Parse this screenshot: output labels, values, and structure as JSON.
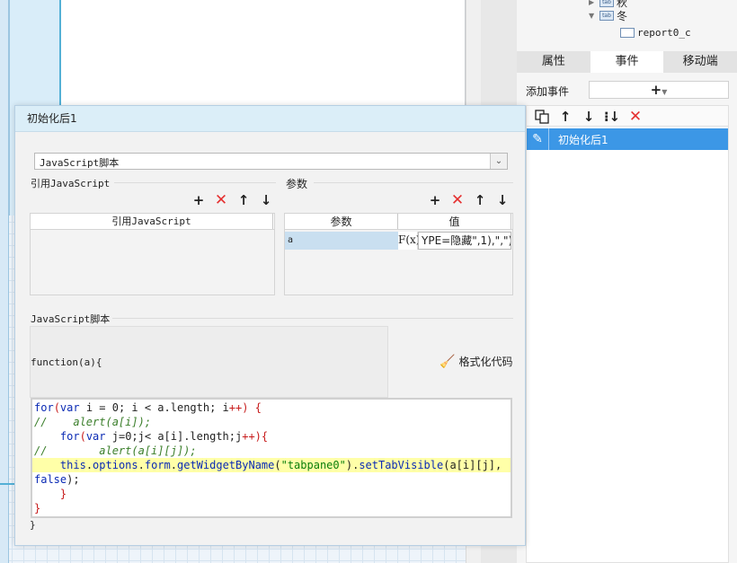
{
  "tree": {
    "items": [
      {
        "label": "秋",
        "icon": "tab-icon",
        "expanded": false
      },
      {
        "label": "冬",
        "icon": "tab-icon",
        "expanded": true
      },
      {
        "label": "report0_c",
        "icon": "report-icon"
      }
    ]
  },
  "panel_tabs": [
    {
      "label": "属性",
      "active": false
    },
    {
      "label": "事件",
      "active": true
    },
    {
      "label": "移动端",
      "active": false
    }
  ],
  "add_event": {
    "label": "添加事件",
    "button_glyph": "+",
    "button_icon": "plus-icon"
  },
  "event_toolbar": [
    "copy-icon",
    "arrow-up-icon",
    "arrow-down-icon",
    "move-down-icon",
    "delete-icon"
  ],
  "events": [
    {
      "label": "初始化后1",
      "selected": true
    }
  ],
  "dialog": {
    "title": "初始化后1",
    "script_type": {
      "value": "JavaScript脚本",
      "options_visible": [
        "JavaScript脚本"
      ]
    },
    "ref_js": {
      "group_label": "引用JavaScript",
      "columns": [
        "引用JavaScript"
      ],
      "rows": []
    },
    "params": {
      "group_label": "参数",
      "columns": [
        "参数",
        "值"
      ],
      "rows": [
        {
          "name": "a",
          "fx": "F(x)",
          "value": "YPE=隐藏\",1),\",\")"
        }
      ]
    },
    "script_section": {
      "group_label": "JavaScript脚本",
      "function_signature": "function(a){",
      "format_button": "格式化代码",
      "closing_brace": "}"
    },
    "code": [
      "for(var i = 0; i < a.length; i++) {",
      "//    alert(a[i]);",
      "    for(var j=0;j< a[i].length;j++){",
      "//        alert(a[i][j]);",
      "    this.options.form.getWidgetByName(\"tabpane0\").setTabVisible(a[i][j],",
      "false);",
      "    }",
      "}"
    ]
  },
  "colors": {
    "selection": "#3c97e6",
    "dialog_title_bg": "#dbeef8",
    "code_highlight": "#ffffa8",
    "keyword": "#0a2ab4",
    "string": "#0a7e0a",
    "delete_red": "#e53030"
  }
}
